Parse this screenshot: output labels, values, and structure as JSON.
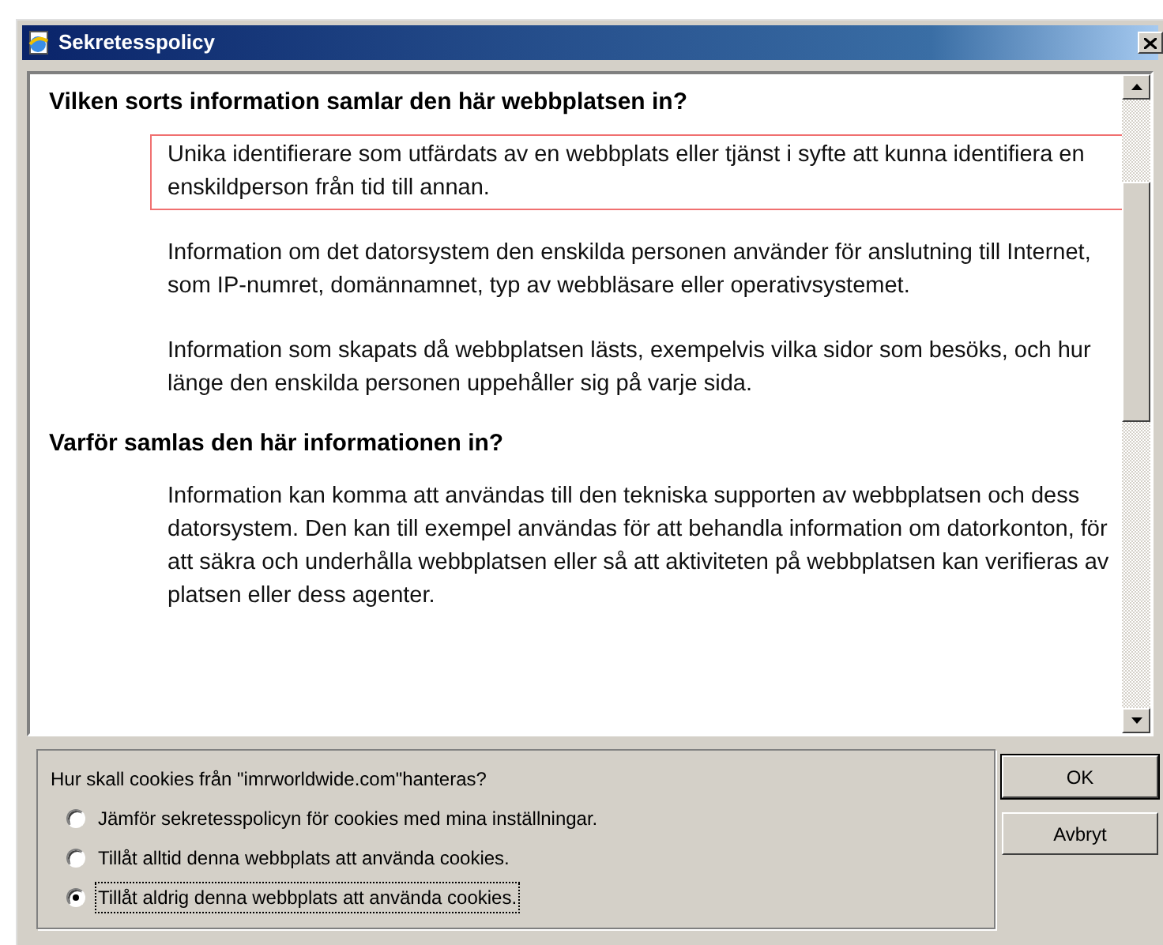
{
  "window": {
    "title": "Sekretesspolicy"
  },
  "policy": [
    {
      "kind": "heading",
      "text": "Vilken sorts information samlar den här webbplatsen in?"
    },
    {
      "kind": "item",
      "highlighted": true,
      "text": "Unika identifierare som utfärdats av en webbplats eller tjänst i syfte att kunna identifiera en enskildperson från tid till annan."
    },
    {
      "kind": "item",
      "highlighted": false,
      "text": "Information om det datorsystem den enskilda personen använder för anslutning till Internet, som IP-numret, domännamnet, typ av webbläsare eller operativsystemet."
    },
    {
      "kind": "item",
      "highlighted": false,
      "text": "Information som skapats då webbplatsen lästs, exempelvis vilka sidor som besöks, och hur länge den enskilda personen uppehåller sig på varje sida."
    },
    {
      "kind": "heading",
      "text": "Varför samlas den här informationen in?"
    },
    {
      "kind": "item",
      "highlighted": false,
      "text": "Information kan komma att användas till den tekniska supporten av webbplatsen och dess datorsystem. Den kan till exempel användas för att behandla information om datorkonton, för att säkra och underhålla webbplatsen eller så att aktiviteten på webbplatsen kan verifieras av platsen eller dess agenter."
    }
  ],
  "cookie_question": "Hur skall cookies från \"imrworldwide.com\"hanteras?",
  "options": [
    {
      "label": "Jämför sekretesspolicyn för cookies med mina inställningar.",
      "selected": false
    },
    {
      "label": "Tillåt alltid denna webbplats att använda cookies.",
      "selected": false
    },
    {
      "label": "Tillåt aldrig denna webbplats att använda cookies.",
      "selected": true
    }
  ],
  "buttons": [
    "OK",
    "Avbryt"
  ]
}
